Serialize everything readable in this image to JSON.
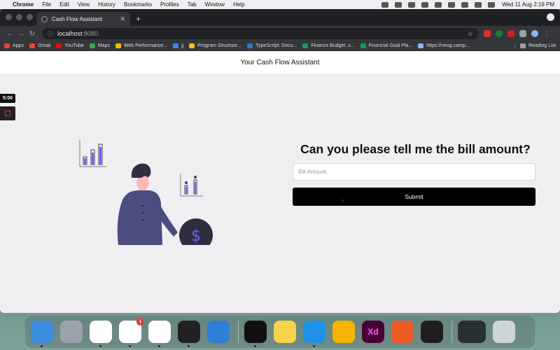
{
  "menubar": {
    "items": [
      {
        "label": "Chrome",
        "bold": true
      },
      {
        "label": "File"
      },
      {
        "label": "Edit"
      },
      {
        "label": "View"
      },
      {
        "label": "History"
      },
      {
        "label": "Bookmarks"
      },
      {
        "label": "Profiles"
      },
      {
        "label": "Tab"
      },
      {
        "label": "Window"
      },
      {
        "label": "Help"
      }
    ],
    "clock": "Wed 11 Aug  2:19 PM"
  },
  "browser": {
    "tab_title": "Cash Flow Assistant",
    "new_tab_symbol": "+",
    "url_host": "localhost",
    "url_port": ":8080",
    "bookmarks": [
      {
        "label": "Apps",
        "color": "#ea4335"
      },
      {
        "label": "Gmail",
        "color": "#ea4335"
      },
      {
        "label": "YouTube",
        "color": "#ff0000"
      },
      {
        "label": "Maps",
        "color": "#34a853"
      },
      {
        "label": "Web Performance...",
        "color": "#fbbc05"
      },
      {
        "label": "jj",
        "color": "#4285f4"
      },
      {
        "label": "Program Structure...",
        "color": "#f4c20d"
      },
      {
        "label": "TypeScript: Docu...",
        "color": "#3178c6"
      },
      {
        "label": "Finance Budget .x...",
        "color": "#0f9d58"
      },
      {
        "label": "Financial Goal Pla...",
        "color": "#0f9d58"
      },
      {
        "label": "https://neog.camp...",
        "color": "#8ab4f8"
      }
    ],
    "reading_list": "Reading List"
  },
  "app": {
    "header_title": "Your Cash Flow Assistant",
    "question": "Can you please tell me the bill amount?",
    "bill_input": {
      "placeholder": "Bill Amount",
      "value": ""
    },
    "submit_label": "Submit",
    "accent": "#000000",
    "illustration_accent": "#6c63ff"
  },
  "overlay": {
    "timer": "5:00"
  },
  "dock": {
    "apps": [
      {
        "name": "finder-icon",
        "color": "#3b8ede"
      },
      {
        "name": "launchpad-icon",
        "color": "#9aa3ab"
      },
      {
        "name": "chrome-icon",
        "color": "#ffffff"
      },
      {
        "name": "slack-icon",
        "color": "#ffffff",
        "badge": "1"
      },
      {
        "name": "vscode-icon",
        "color": "#ffffff"
      },
      {
        "name": "terminal-icon",
        "color": "#222222"
      },
      {
        "name": "xcode-icon",
        "color": "#2d7fd8"
      },
      {
        "name": "iterm-icon",
        "color": "#111111"
      },
      {
        "name": "notes-icon",
        "color": "#f7d34a"
      },
      {
        "name": "docker-icon",
        "color": "#1d91e6"
      },
      {
        "name": "tableplus-icon",
        "color": "#f4b400"
      },
      {
        "name": "adobe-xd-icon",
        "color": "#470137",
        "text": "Xd"
      },
      {
        "name": "postman-icon",
        "color": "#ef5b25"
      },
      {
        "name": "figma-icon",
        "color": "#1e1e1e"
      },
      {
        "name": "downloads-icon",
        "color": "#2a2f33"
      },
      {
        "name": "trash-icon",
        "color": "#cfd4d8"
      }
    ]
  }
}
